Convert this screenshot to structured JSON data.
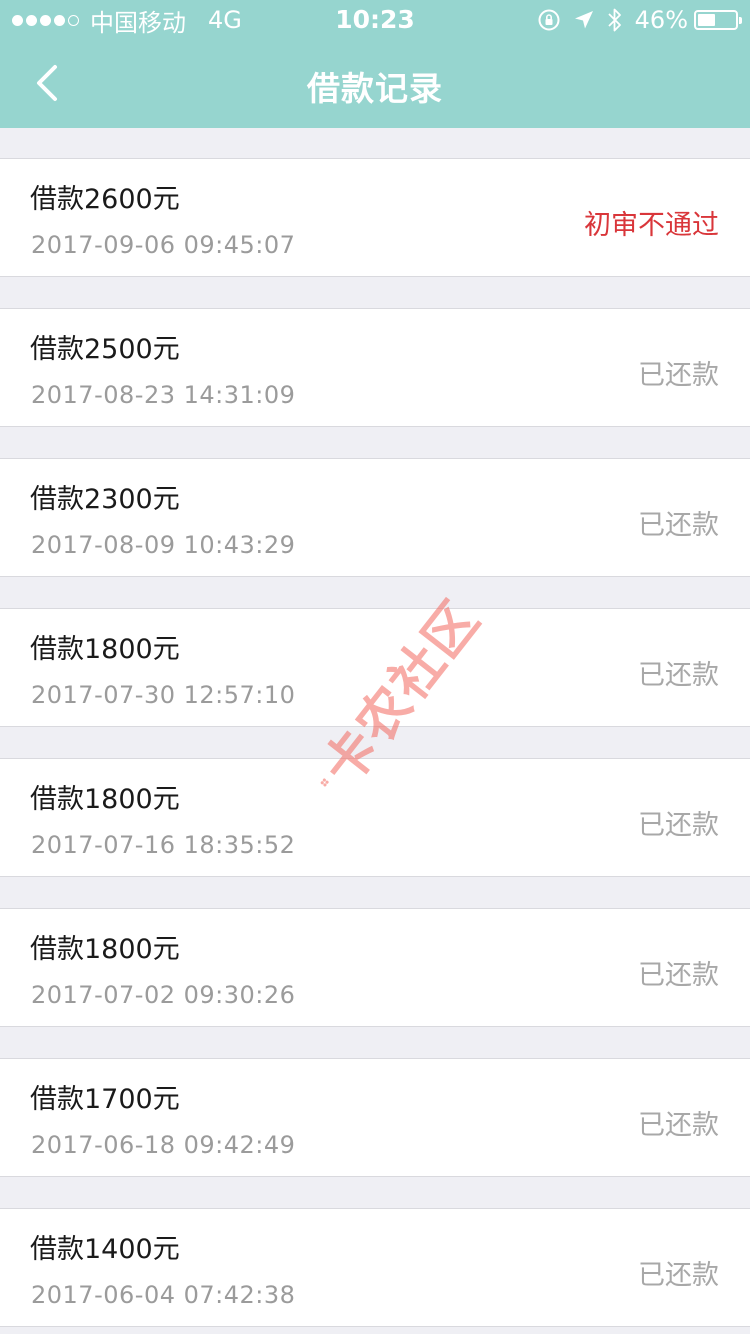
{
  "status_bar": {
    "carrier": "中国移动",
    "network": "4G",
    "time": "10:23",
    "battery_percent": "46%",
    "battery_level": 0.46,
    "icons": [
      "orientation-lock-icon",
      "location-arrow-icon",
      "bluetooth-icon",
      "battery-icon"
    ]
  },
  "nav": {
    "title": "借款记录",
    "back_icon": "chevron-left-icon"
  },
  "colors": {
    "header_bg": "#96d5cf",
    "page_bg": "#efeff4",
    "rejected": "#d9363a",
    "muted": "#a8a8a8"
  },
  "records": [
    {
      "amount": "借款2600元",
      "time": "2017-09-06 09:45:07",
      "status": "初审不通过"
    },
    {
      "amount": "借款2500元",
      "time": "2017-08-23 14:31:09",
      "status": "已还款"
    },
    {
      "amount": "借款2300元",
      "time": "2017-08-09 10:43:29",
      "status": "已还款"
    },
    {
      "amount": "借款1800元",
      "time": "2017-07-30 12:57:10",
      "status": "已还款"
    },
    {
      "amount": "借款1800元",
      "time": "2017-07-16 18:35:52",
      "status": "已还款"
    },
    {
      "amount": "借款1800元",
      "time": "2017-07-02 09:30:26",
      "status": "已还款"
    },
    {
      "amount": "借款1700元",
      "time": "2017-06-18 09:42:49",
      "status": "已还款"
    },
    {
      "amount": "借款1400元",
      "time": "2017-06-04 07:42:38",
      "status": "已还款"
    }
  ],
  "watermark": {
    "text": "卡农社区"
  }
}
